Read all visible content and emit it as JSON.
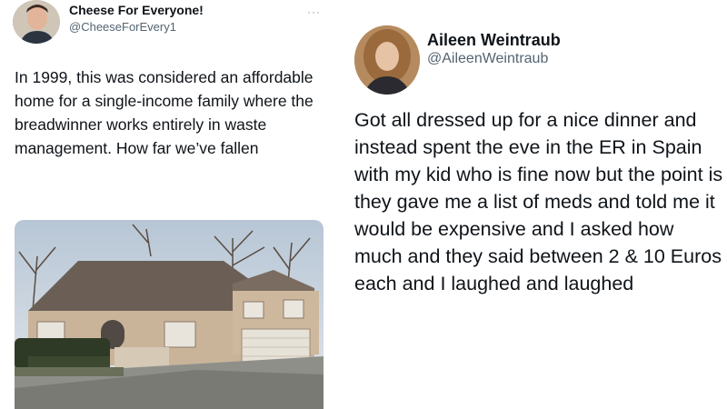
{
  "left_tweet": {
    "display_name": "Cheese For Everyone!",
    "handle": "@CheeseForEvery1",
    "more_glyph": "···",
    "text": "In 1999, this was considered an affordable home for a single-income family where the breadwinner works entirely in waste management. How far we’ve fallen",
    "photo_icon": "house-photo"
  },
  "right_tweet": {
    "display_name": "Aileen Weintraub",
    "handle": "@AileenWeintraub",
    "text": "Got all dressed up for a nice dinner and instead spent the eve in the ER in Spain with my kid who is fine now but the point is they gave me a list of meds and told me it would be expensive and I asked how much and they said between 2 & 10 Euros each and I laughed and laughed"
  },
  "colors": {
    "text": "#0f1419",
    "secondary": "#536471",
    "background": "#ffffff"
  }
}
